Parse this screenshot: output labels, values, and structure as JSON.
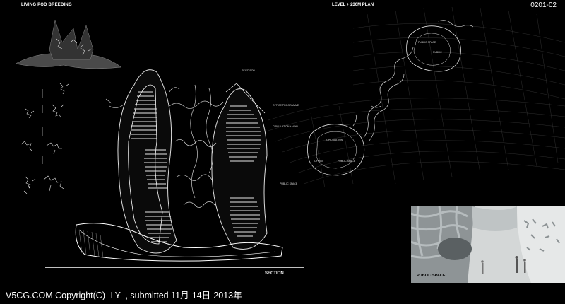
{
  "sheet": {
    "title_left": "LIVING POD BREEDING",
    "title_plan": "LEVEL + 230m PLAN",
    "sheet_number": "0201-02",
    "section_label": "SECTION"
  },
  "annotations": {
    "section": [
      "SKIED POD",
      "OFFICE PROGRAMME",
      "CIRCULATION + VOID",
      "PUBLIC SPACE"
    ],
    "plan_upper": [
      "PUBLIC SPACE",
      "PUBLIC"
    ],
    "plan_lower": [
      "CIRCULATION",
      "OFFICE",
      "PUBLIC SPACE"
    ]
  },
  "render": {
    "label": "PUBLIC SPACE"
  },
  "footer": {
    "text": "V5CG.COM   Copyright(C)  -LY- ,   submitted 11月-14日-2013年"
  }
}
